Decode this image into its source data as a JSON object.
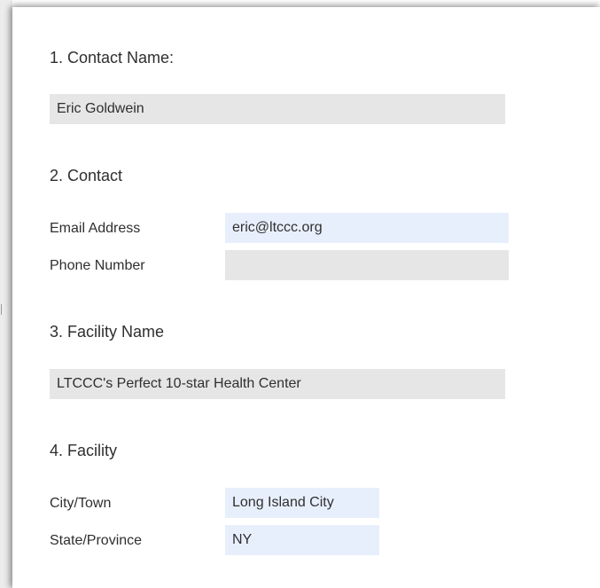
{
  "form": {
    "contact_name": {
      "label": "1. Contact Name:",
      "value": "Eric Goldwein"
    },
    "contact": {
      "label": "2. Contact",
      "email_label": "Email Address",
      "email_value": "eric@ltccc.org",
      "phone_label": "Phone Number",
      "phone_value": ""
    },
    "facility_name": {
      "label": "3. Facility Name",
      "value": "LTCCC's Perfect 10-star Health Center"
    },
    "facility": {
      "label": "4. Facility",
      "city_label": "City/Town",
      "city_value": "Long Island City",
      "state_label": "State/Province",
      "state_value": "NY"
    }
  },
  "colors": {
    "readonly_field": "#e6e6e6",
    "autofill_field": "#e8effc",
    "text": "#2f2f2f"
  }
}
